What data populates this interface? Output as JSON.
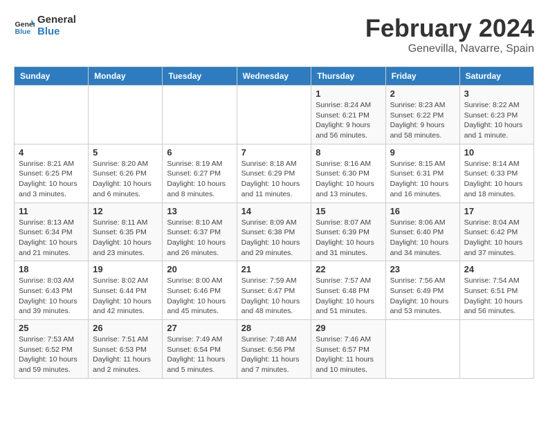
{
  "header": {
    "logo_line1": "General",
    "logo_line2": "Blue",
    "main_title": "February 2024",
    "subtitle": "Genevilla, Navarre, Spain"
  },
  "calendar": {
    "days_of_week": [
      "Sunday",
      "Monday",
      "Tuesday",
      "Wednesday",
      "Thursday",
      "Friday",
      "Saturday"
    ],
    "weeks": [
      [
        {
          "num": "",
          "info": ""
        },
        {
          "num": "",
          "info": ""
        },
        {
          "num": "",
          "info": ""
        },
        {
          "num": "",
          "info": ""
        },
        {
          "num": "1",
          "info": "Sunrise: 8:24 AM\nSunset: 6:21 PM\nDaylight: 9 hours\nand 56 minutes."
        },
        {
          "num": "2",
          "info": "Sunrise: 8:23 AM\nSunset: 6:22 PM\nDaylight: 9 hours\nand 58 minutes."
        },
        {
          "num": "3",
          "info": "Sunrise: 8:22 AM\nSunset: 6:23 PM\nDaylight: 10 hours\nand 1 minute."
        }
      ],
      [
        {
          "num": "4",
          "info": "Sunrise: 8:21 AM\nSunset: 6:25 PM\nDaylight: 10 hours\nand 3 minutes."
        },
        {
          "num": "5",
          "info": "Sunrise: 8:20 AM\nSunset: 6:26 PM\nDaylight: 10 hours\nand 6 minutes."
        },
        {
          "num": "6",
          "info": "Sunrise: 8:19 AM\nSunset: 6:27 PM\nDaylight: 10 hours\nand 8 minutes."
        },
        {
          "num": "7",
          "info": "Sunrise: 8:18 AM\nSunset: 6:29 PM\nDaylight: 10 hours\nand 11 minutes."
        },
        {
          "num": "8",
          "info": "Sunrise: 8:16 AM\nSunset: 6:30 PM\nDaylight: 10 hours\nand 13 minutes."
        },
        {
          "num": "9",
          "info": "Sunrise: 8:15 AM\nSunset: 6:31 PM\nDaylight: 10 hours\nand 16 minutes."
        },
        {
          "num": "10",
          "info": "Sunrise: 8:14 AM\nSunset: 6:33 PM\nDaylight: 10 hours\nand 18 minutes."
        }
      ],
      [
        {
          "num": "11",
          "info": "Sunrise: 8:13 AM\nSunset: 6:34 PM\nDaylight: 10 hours\nand 21 minutes."
        },
        {
          "num": "12",
          "info": "Sunrise: 8:11 AM\nSunset: 6:35 PM\nDaylight: 10 hours\nand 23 minutes."
        },
        {
          "num": "13",
          "info": "Sunrise: 8:10 AM\nSunset: 6:37 PM\nDaylight: 10 hours\nand 26 minutes."
        },
        {
          "num": "14",
          "info": "Sunrise: 8:09 AM\nSunset: 6:38 PM\nDaylight: 10 hours\nand 29 minutes."
        },
        {
          "num": "15",
          "info": "Sunrise: 8:07 AM\nSunset: 6:39 PM\nDaylight: 10 hours\nand 31 minutes."
        },
        {
          "num": "16",
          "info": "Sunrise: 8:06 AM\nSunset: 6:40 PM\nDaylight: 10 hours\nand 34 minutes."
        },
        {
          "num": "17",
          "info": "Sunrise: 8:04 AM\nSunset: 6:42 PM\nDaylight: 10 hours\nand 37 minutes."
        }
      ],
      [
        {
          "num": "18",
          "info": "Sunrise: 8:03 AM\nSunset: 6:43 PM\nDaylight: 10 hours\nand 39 minutes."
        },
        {
          "num": "19",
          "info": "Sunrise: 8:02 AM\nSunset: 6:44 PM\nDaylight: 10 hours\nand 42 minutes."
        },
        {
          "num": "20",
          "info": "Sunrise: 8:00 AM\nSunset: 6:46 PM\nDaylight: 10 hours\nand 45 minutes."
        },
        {
          "num": "21",
          "info": "Sunrise: 7:59 AM\nSunset: 6:47 PM\nDaylight: 10 hours\nand 48 minutes."
        },
        {
          "num": "22",
          "info": "Sunrise: 7:57 AM\nSunset: 6:48 PM\nDaylight: 10 hours\nand 51 minutes."
        },
        {
          "num": "23",
          "info": "Sunrise: 7:56 AM\nSunset: 6:49 PM\nDaylight: 10 hours\nand 53 minutes."
        },
        {
          "num": "24",
          "info": "Sunrise: 7:54 AM\nSunset: 6:51 PM\nDaylight: 10 hours\nand 56 minutes."
        }
      ],
      [
        {
          "num": "25",
          "info": "Sunrise: 7:53 AM\nSunset: 6:52 PM\nDaylight: 10 hours\nand 59 minutes."
        },
        {
          "num": "26",
          "info": "Sunrise: 7:51 AM\nSunset: 6:53 PM\nDaylight: 11 hours\nand 2 minutes."
        },
        {
          "num": "27",
          "info": "Sunrise: 7:49 AM\nSunset: 6:54 PM\nDaylight: 11 hours\nand 5 minutes."
        },
        {
          "num": "28",
          "info": "Sunrise: 7:48 AM\nSunset: 6:56 PM\nDaylight: 11 hours\nand 7 minutes."
        },
        {
          "num": "29",
          "info": "Sunrise: 7:46 AM\nSunset: 6:57 PM\nDaylight: 11 hours\nand 10 minutes."
        },
        {
          "num": "",
          "info": ""
        },
        {
          "num": "",
          "info": ""
        }
      ]
    ]
  }
}
